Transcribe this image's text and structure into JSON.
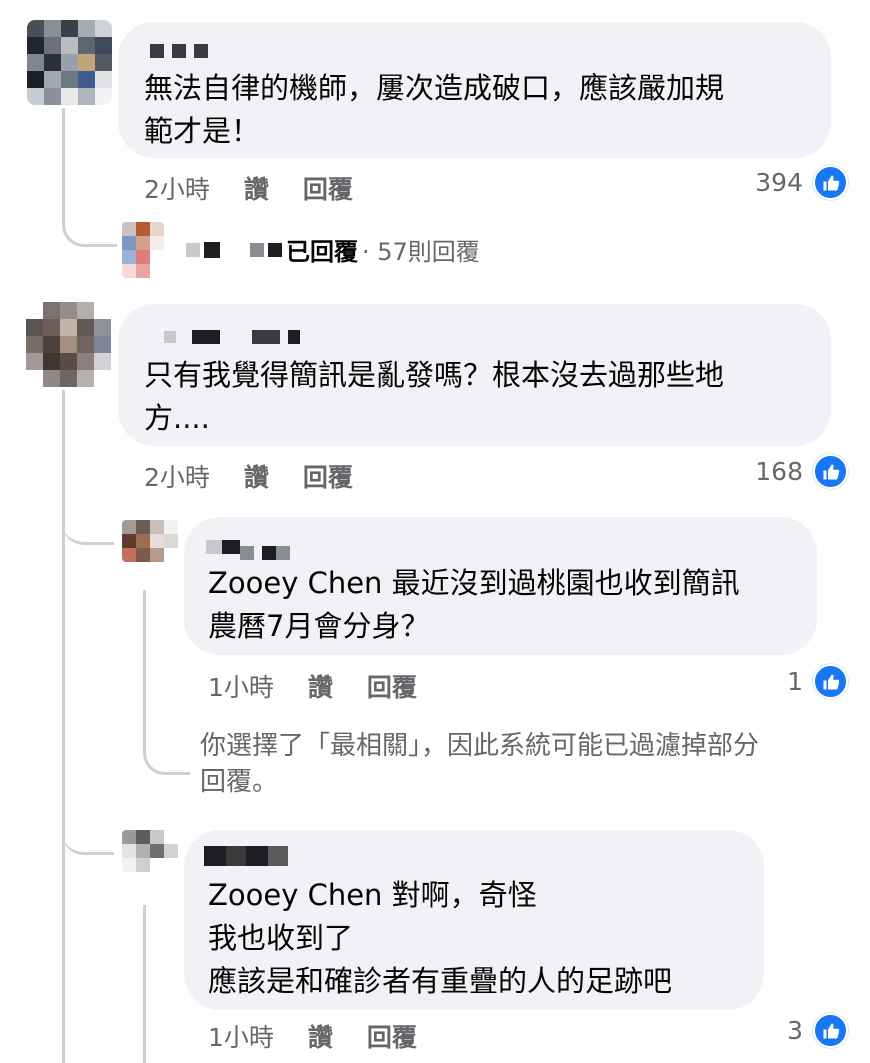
{
  "comments": [
    {
      "author_label": "■ ■ ■",
      "text": "無法自律的機師，屢次造成破口，應該嚴加規\n範才是！",
      "time": "2小時",
      "like_label": "讚",
      "reply_label": "回覆",
      "reaction_count": "394",
      "replies_summary": {
        "author_fragment": "已回覆",
        "count_text": "· 57則回覆"
      }
    },
    {
      "author_label": "",
      "text": "只有我覺得簡訊是亂發嗎？根本沒去過那些地\n方....",
      "time": "2小時",
      "like_label": "讚",
      "reply_label": "回覆",
      "reaction_count": "168",
      "replies": [
        {
          "author_label": "",
          "text": "Zooey Chen 最近沒到過桃園也收到簡訊\n農曆7月會分身？",
          "time": "1小時",
          "like_label": "讚",
          "reply_label": "回覆",
          "reaction_count": "1"
        },
        {
          "author_label": "",
          "text": "Zooey Chen 對啊，奇怪\n我也收到了\n應該是和確診者有重疊的人的足跡吧",
          "time": "1小時",
          "like_label": "讚",
          "reply_label": "回覆",
          "reaction_count": "3"
        }
      ],
      "filter_note": "你選擇了「最相關」，因此系統可能已過濾掉部分\n回覆。"
    }
  ],
  "colors": {
    "bubble": "#f0f2f5",
    "meta_text": "#65676b",
    "like_blue": "#1877f2",
    "thread_line": "#ccd0d5"
  },
  "icons": {
    "reaction": "thumbs-up-icon"
  }
}
